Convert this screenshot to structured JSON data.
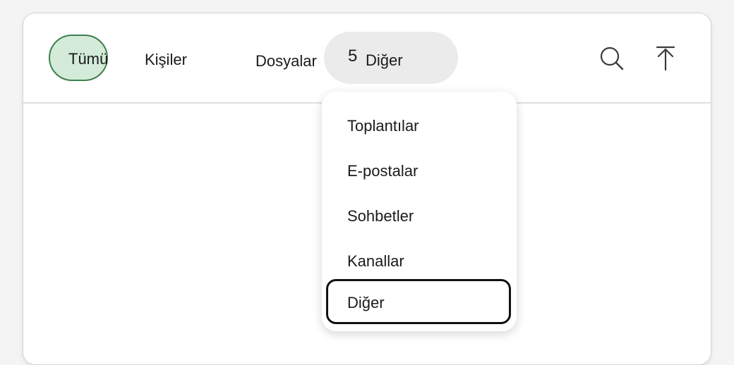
{
  "tabs": {
    "all_label": "Tümü",
    "people_label": "Kişiler",
    "files_label": "Dosyalar",
    "other_count": "5",
    "other_label": "Diğer"
  },
  "icons": {
    "search": "search-icon",
    "scroll_top": "arrow-up-to-top-icon"
  },
  "colors": {
    "selected_tab_fill": "#d3ebd8",
    "selected_tab_border": "#3f7f4d",
    "open_tab_fill": "#ebebeb",
    "focus_ring": "#111111"
  },
  "dropdown": {
    "items": [
      {
        "label": "Toplantılar"
      },
      {
        "label": "E-postalar"
      },
      {
        "label": "Sohbetler"
      },
      {
        "label": "Kanallar"
      },
      {
        "label": "Diğer",
        "focused": true
      }
    ]
  }
}
